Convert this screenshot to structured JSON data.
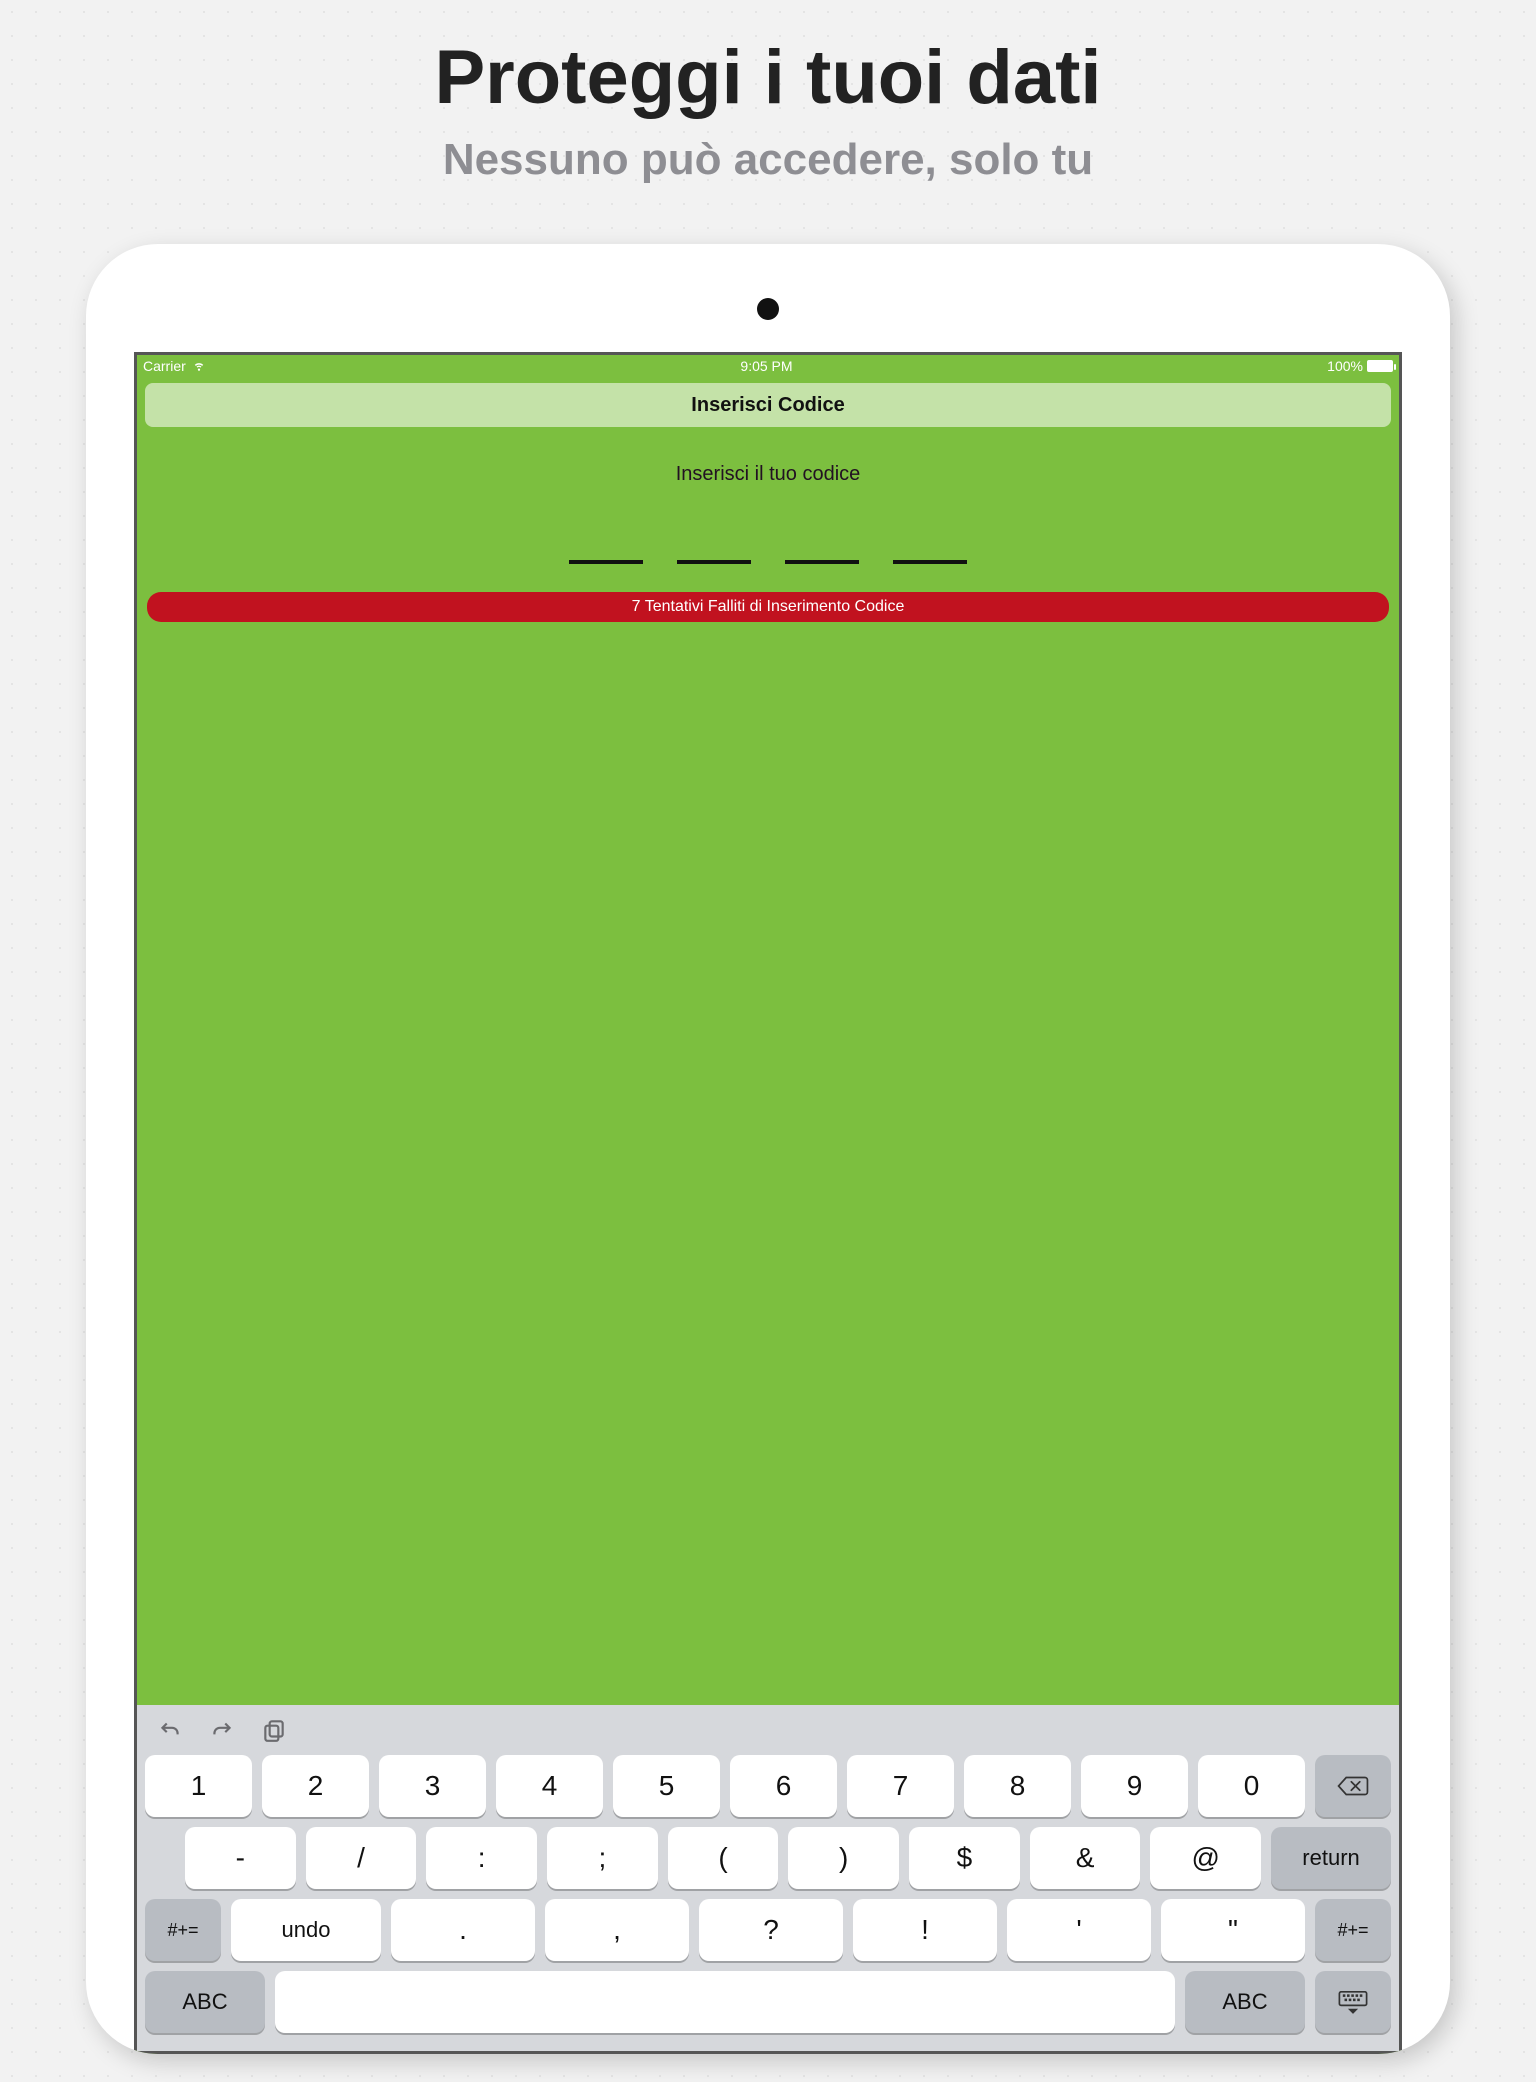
{
  "marketing": {
    "headline": "Proteggi i tuoi dati",
    "subhead": "Nessuno può accedere, solo tu"
  },
  "status": {
    "carrier": "Carrier",
    "time": "9:05 PM",
    "battery_pct": "100%"
  },
  "lock": {
    "title": "Inserisci Codice",
    "prompt": "Inserisci il tuo codice",
    "alert": "7 Tentativi Falliti di Inserimento Codice"
  },
  "keyboard": {
    "row1": [
      "1",
      "2",
      "3",
      "4",
      "5",
      "6",
      "7",
      "8",
      "9",
      "0"
    ],
    "row2": [
      "-",
      "/",
      ":",
      ";",
      "(",
      ")",
      "$",
      "&",
      "@"
    ],
    "return": "return",
    "shift": "#+=",
    "undo": "undo",
    "row3": [
      ".",
      ",",
      "?",
      "!",
      "'",
      "\""
    ],
    "abc": "ABC"
  }
}
